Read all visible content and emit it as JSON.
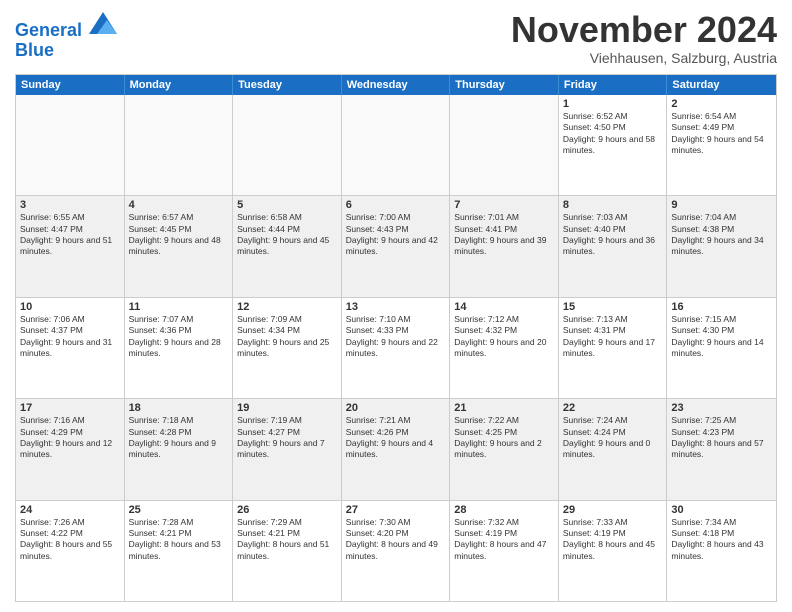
{
  "logo": {
    "line1": "General",
    "line2": "Blue"
  },
  "title": "November 2024",
  "subtitle": "Viehhausen, Salzburg, Austria",
  "header_days": [
    "Sunday",
    "Monday",
    "Tuesday",
    "Wednesday",
    "Thursday",
    "Friday",
    "Saturday"
  ],
  "rows": [
    [
      {
        "day": "",
        "text": "",
        "empty": true
      },
      {
        "day": "",
        "text": "",
        "empty": true
      },
      {
        "day": "",
        "text": "",
        "empty": true
      },
      {
        "day": "",
        "text": "",
        "empty": true
      },
      {
        "day": "",
        "text": "",
        "empty": true
      },
      {
        "day": "1",
        "text": "Sunrise: 6:52 AM\nSunset: 4:50 PM\nDaylight: 9 hours and 58 minutes."
      },
      {
        "day": "2",
        "text": "Sunrise: 6:54 AM\nSunset: 4:49 PM\nDaylight: 9 hours and 54 minutes."
      }
    ],
    [
      {
        "day": "3",
        "text": "Sunrise: 6:55 AM\nSunset: 4:47 PM\nDaylight: 9 hours and 51 minutes."
      },
      {
        "day": "4",
        "text": "Sunrise: 6:57 AM\nSunset: 4:45 PM\nDaylight: 9 hours and 48 minutes."
      },
      {
        "day": "5",
        "text": "Sunrise: 6:58 AM\nSunset: 4:44 PM\nDaylight: 9 hours and 45 minutes."
      },
      {
        "day": "6",
        "text": "Sunrise: 7:00 AM\nSunset: 4:43 PM\nDaylight: 9 hours and 42 minutes."
      },
      {
        "day": "7",
        "text": "Sunrise: 7:01 AM\nSunset: 4:41 PM\nDaylight: 9 hours and 39 minutes."
      },
      {
        "day": "8",
        "text": "Sunrise: 7:03 AM\nSunset: 4:40 PM\nDaylight: 9 hours and 36 minutes."
      },
      {
        "day": "9",
        "text": "Sunrise: 7:04 AM\nSunset: 4:38 PM\nDaylight: 9 hours and 34 minutes."
      }
    ],
    [
      {
        "day": "10",
        "text": "Sunrise: 7:06 AM\nSunset: 4:37 PM\nDaylight: 9 hours and 31 minutes."
      },
      {
        "day": "11",
        "text": "Sunrise: 7:07 AM\nSunset: 4:36 PM\nDaylight: 9 hours and 28 minutes."
      },
      {
        "day": "12",
        "text": "Sunrise: 7:09 AM\nSunset: 4:34 PM\nDaylight: 9 hours and 25 minutes."
      },
      {
        "day": "13",
        "text": "Sunrise: 7:10 AM\nSunset: 4:33 PM\nDaylight: 9 hours and 22 minutes."
      },
      {
        "day": "14",
        "text": "Sunrise: 7:12 AM\nSunset: 4:32 PM\nDaylight: 9 hours and 20 minutes."
      },
      {
        "day": "15",
        "text": "Sunrise: 7:13 AM\nSunset: 4:31 PM\nDaylight: 9 hours and 17 minutes."
      },
      {
        "day": "16",
        "text": "Sunrise: 7:15 AM\nSunset: 4:30 PM\nDaylight: 9 hours and 14 minutes."
      }
    ],
    [
      {
        "day": "17",
        "text": "Sunrise: 7:16 AM\nSunset: 4:29 PM\nDaylight: 9 hours and 12 minutes."
      },
      {
        "day": "18",
        "text": "Sunrise: 7:18 AM\nSunset: 4:28 PM\nDaylight: 9 hours and 9 minutes."
      },
      {
        "day": "19",
        "text": "Sunrise: 7:19 AM\nSunset: 4:27 PM\nDaylight: 9 hours and 7 minutes."
      },
      {
        "day": "20",
        "text": "Sunrise: 7:21 AM\nSunset: 4:26 PM\nDaylight: 9 hours and 4 minutes."
      },
      {
        "day": "21",
        "text": "Sunrise: 7:22 AM\nSunset: 4:25 PM\nDaylight: 9 hours and 2 minutes."
      },
      {
        "day": "22",
        "text": "Sunrise: 7:24 AM\nSunset: 4:24 PM\nDaylight: 9 hours and 0 minutes."
      },
      {
        "day": "23",
        "text": "Sunrise: 7:25 AM\nSunset: 4:23 PM\nDaylight: 8 hours and 57 minutes."
      }
    ],
    [
      {
        "day": "24",
        "text": "Sunrise: 7:26 AM\nSunset: 4:22 PM\nDaylight: 8 hours and 55 minutes."
      },
      {
        "day": "25",
        "text": "Sunrise: 7:28 AM\nSunset: 4:21 PM\nDaylight: 8 hours and 53 minutes."
      },
      {
        "day": "26",
        "text": "Sunrise: 7:29 AM\nSunset: 4:21 PM\nDaylight: 8 hours and 51 minutes."
      },
      {
        "day": "27",
        "text": "Sunrise: 7:30 AM\nSunset: 4:20 PM\nDaylight: 8 hours and 49 minutes."
      },
      {
        "day": "28",
        "text": "Sunrise: 7:32 AM\nSunset: 4:19 PM\nDaylight: 8 hours and 47 minutes."
      },
      {
        "day": "29",
        "text": "Sunrise: 7:33 AM\nSunset: 4:19 PM\nDaylight: 8 hours and 45 minutes."
      },
      {
        "day": "30",
        "text": "Sunrise: 7:34 AM\nSunset: 4:18 PM\nDaylight: 8 hours and 43 minutes."
      }
    ]
  ]
}
